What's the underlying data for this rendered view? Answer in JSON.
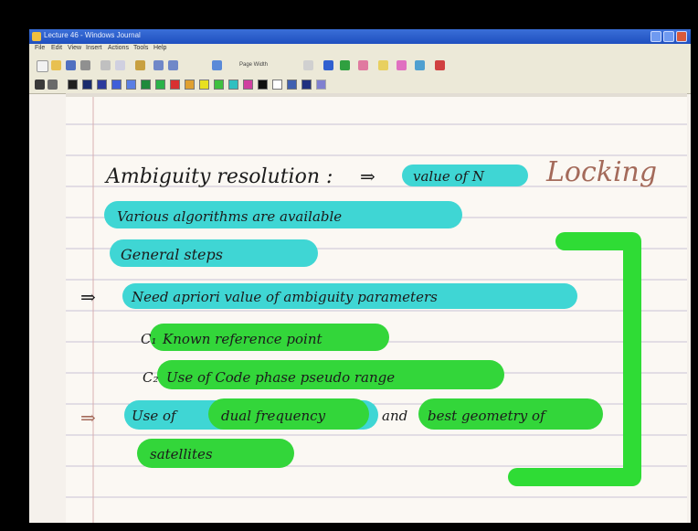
{
  "window": {
    "title": "Lecture 46 - Windows Journal",
    "accent": "#1f4fbf"
  },
  "menu": [
    "File",
    "Edit",
    "View",
    "Insert",
    "Actions",
    "Tools",
    "Help"
  ],
  "toolbar": {
    "zoom_label": "Page Width",
    "icons": [
      "new-note-icon",
      "open-icon",
      "save-icon",
      "print-icon",
      "pen-icon",
      "eraser-icon",
      "undo-icon",
      "redo-icon",
      "zoom-icon",
      "insert-space-icon",
      "selection-icon",
      "highlighter-icon",
      "flag-icon"
    ],
    "colors": [
      "#202020",
      "#1a2b6c",
      "#2c3a9c",
      "#405ed8",
      "#3f7fd4",
      "#1f8a3c",
      "#2bb24a",
      "#d83030",
      "#e0a030",
      "#e8e020",
      "#40c040",
      "#30c0c0",
      "#d040a0",
      "#101010",
      "#ffffff",
      "#4060b0",
      "#203080",
      "#8080d0"
    ]
  },
  "notes": {
    "line1_text": "Ambiguity resolution :",
    "line1_arrow": "⇒",
    "line1_highlight": "value of N",
    "locking": "Locking",
    "line2": "Various algorithms are available",
    "line3": "General steps",
    "line4_arrow": "⇒",
    "line4": "Need apriori value of ambiguity parameters",
    "line5_bullet": "C₁",
    "line5": "Known reference point",
    "line6_bullet": "C₂",
    "line6": "Use of Code phase pseudo range",
    "line7_arrow": "⇒",
    "line7a": "Use of",
    "line7b": "dual frequency",
    "line7c": "and",
    "line7d": "best geometry of",
    "line8": "satellites",
    "highlight_cyan": "#3fd6d4",
    "highlight_green": "#33d63a",
    "bracket_color": "#2fdc35"
  }
}
